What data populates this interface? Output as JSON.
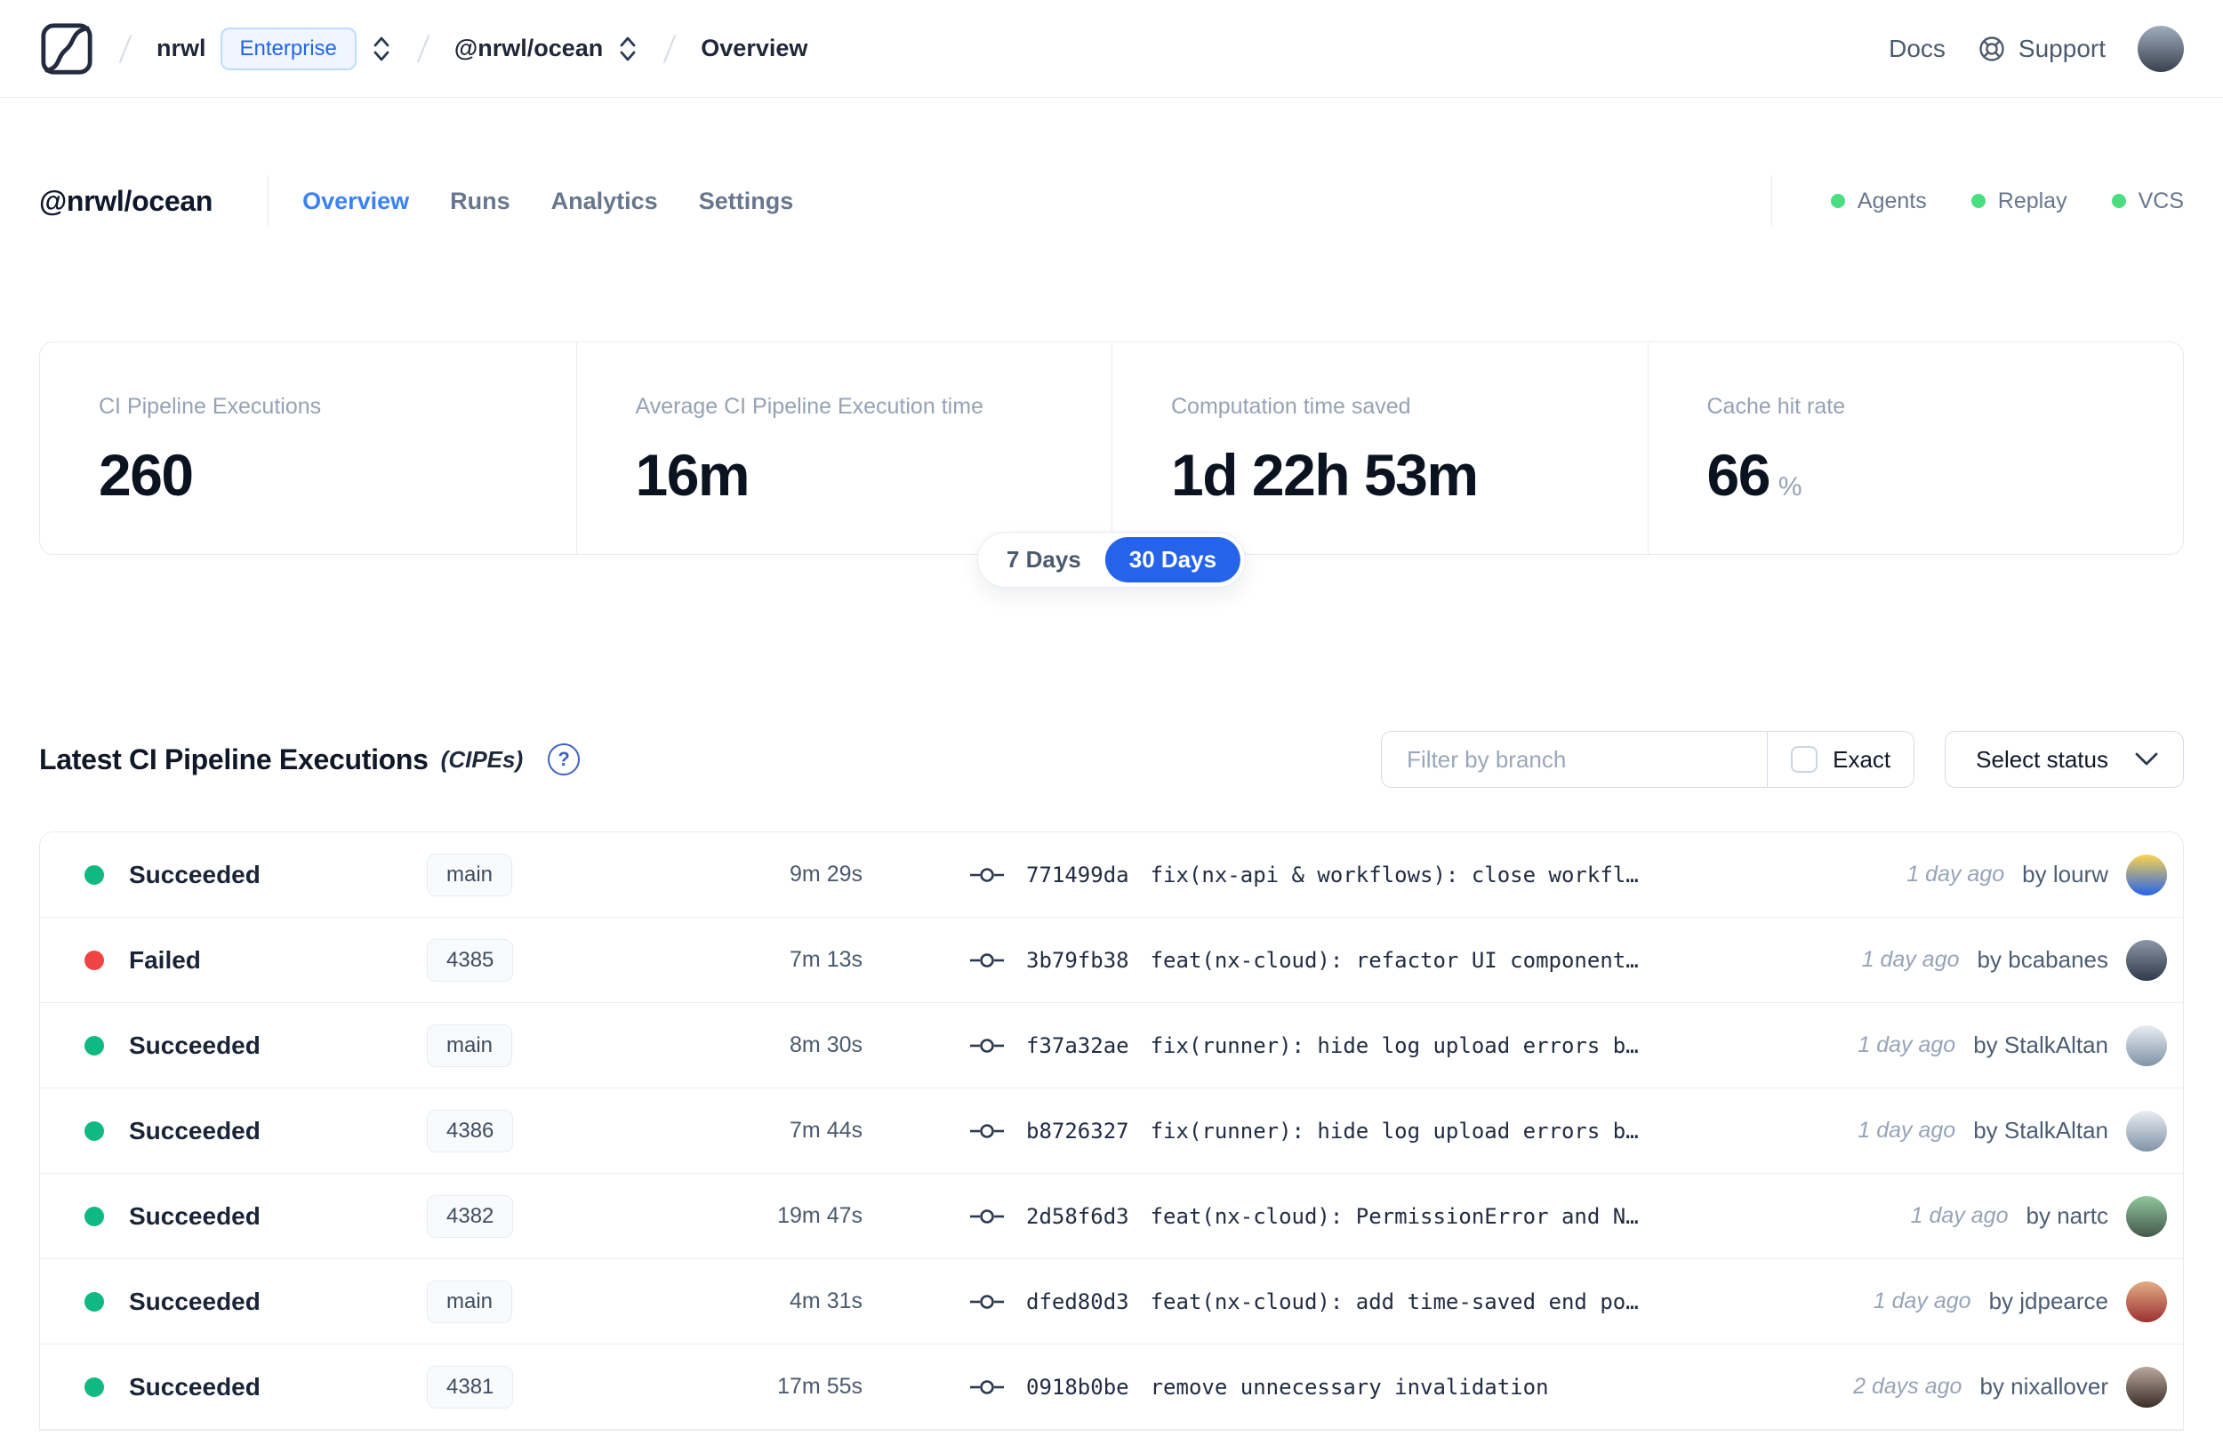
{
  "topbar": {
    "org": "nrwl",
    "plan_badge": "Enterprise",
    "workspace": "@nrwl/ocean",
    "page": "Overview",
    "docs_label": "Docs",
    "support_label": "Support",
    "avatar_colors": [
      "#9fadbe",
      "#39424f"
    ]
  },
  "header": {
    "title": "@nrwl/ocean",
    "active_tab": "Overview",
    "tabs": [
      {
        "label": "Overview"
      },
      {
        "label": "Runs"
      },
      {
        "label": "Analytics"
      },
      {
        "label": "Settings"
      }
    ],
    "services": [
      {
        "label": "Agents"
      },
      {
        "label": "Replay"
      },
      {
        "label": "VCS"
      }
    ]
  },
  "stats": {
    "cards": [
      {
        "label": "CI Pipeline Executions",
        "value": "260",
        "unit": ""
      },
      {
        "label": "Average CI Pipeline Execution time",
        "value": "16m",
        "unit": ""
      },
      {
        "label": "Computation time saved",
        "value": "1d 22h 53m",
        "unit": ""
      },
      {
        "label": "Cache hit rate",
        "value": "66",
        "unit": "%"
      }
    ],
    "range_toggle": {
      "options": [
        "7 Days",
        "30 Days"
      ],
      "selected": "30 Days"
    }
  },
  "cipes": {
    "heading": "Latest CI Pipeline Executions",
    "heading_suffix": "(CIPEs)",
    "help_glyph": "?",
    "filter_placeholder": "Filter by branch",
    "exact_label": "Exact",
    "exact_checked": false,
    "status_select_label": "Select status",
    "by_label": "by",
    "rows": [
      {
        "status": "Succeeded",
        "status_type": "success",
        "branch": "main",
        "duration": "9m 29s",
        "hash": "771499da",
        "message": "fix(nx-api & workflows): close workfl…",
        "time_ago": "1 day ago",
        "author": "lourw",
        "avatar": [
          "#fcd34d",
          "#2563eb"
        ]
      },
      {
        "status": "Failed",
        "status_type": "failed",
        "branch": "4385",
        "duration": "7m 13s",
        "hash": "3b79fb38",
        "message": "feat(nx-cloud): refactor UI component…",
        "time_ago": "1 day ago",
        "author": "bcabanes",
        "avatar": [
          "#8b97a8",
          "#2f3a4a"
        ]
      },
      {
        "status": "Succeeded",
        "status_type": "success",
        "branch": "main",
        "duration": "8m 30s",
        "hash": "f37a32ae",
        "message": "fix(runner): hide log upload errors b…",
        "time_ago": "1 day ago",
        "author": "StalkAltan",
        "avatar": [
          "#e8edf2",
          "#8094a8"
        ]
      },
      {
        "status": "Succeeded",
        "status_type": "success",
        "branch": "4386",
        "duration": "7m 44s",
        "hash": "b8726327",
        "message": "fix(runner): hide log upload errors b…",
        "time_ago": "1 day ago",
        "author": "StalkAltan",
        "avatar": [
          "#e8edf2",
          "#8094a8"
        ]
      },
      {
        "status": "Succeeded",
        "status_type": "success",
        "branch": "4382",
        "duration": "19m 47s",
        "hash": "2d58f6d3",
        "message": "feat(nx-cloud): PermissionError and N…",
        "time_ago": "1 day ago",
        "author": "nartc",
        "avatar": [
          "#8fc79a",
          "#45584e"
        ]
      },
      {
        "status": "Succeeded",
        "status_type": "success",
        "branch": "main",
        "duration": "4m 31s",
        "hash": "dfed80d3",
        "message": "feat(nx-cloud): add time-saved end po…",
        "time_ago": "1 day ago",
        "author": "jdpearce",
        "avatar": [
          "#e3ad85",
          "#9b3032"
        ]
      },
      {
        "status": "Succeeded",
        "status_type": "success",
        "branch": "4381",
        "duration": "17m 55s",
        "hash": "0918b0be",
        "message": "remove unnecessary invalidation",
        "time_ago": "2 days ago",
        "author": "nixallover",
        "avatar": [
          "#b9a79b",
          "#3a2e28"
        ]
      }
    ]
  },
  "colors": {
    "accent": "#2563eb",
    "tab_active": "#3b82f6",
    "enterprise_text": "#2563eb",
    "success": "#10b981",
    "failed": "#ef4444",
    "service_dot": "#4ade80"
  }
}
